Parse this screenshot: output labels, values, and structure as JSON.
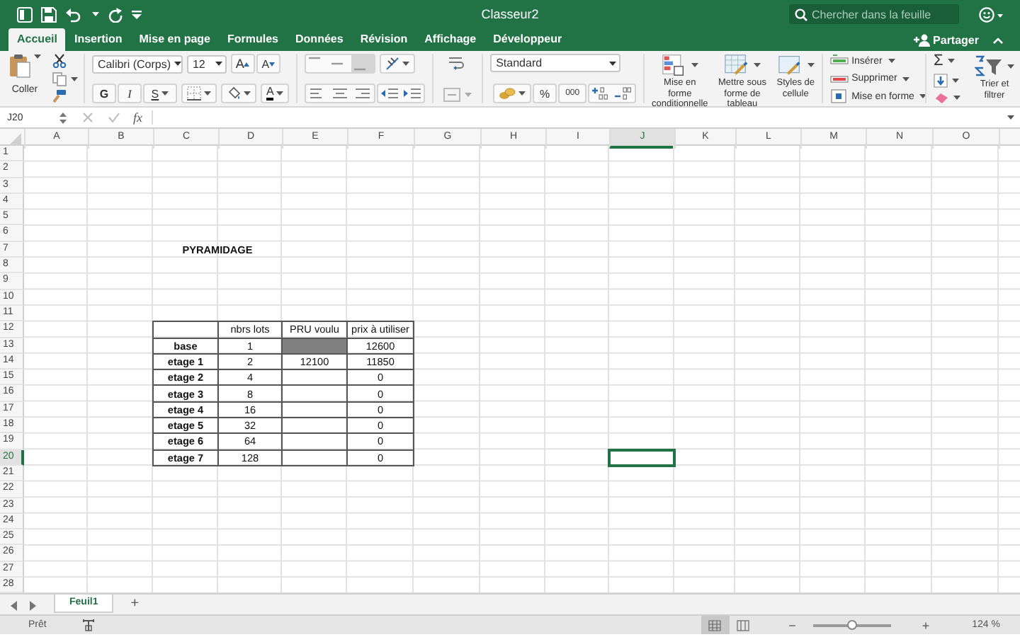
{
  "title_bar": {
    "title": "Classeur2",
    "search": {
      "placeholder": "Chercher dans la feuille"
    }
  },
  "tabs": [
    {
      "label": "Accueil",
      "selected": true
    },
    {
      "label": "Insertion",
      "selected": false
    },
    {
      "label": "Mise en page",
      "selected": false
    },
    {
      "label": "Formules",
      "selected": false
    },
    {
      "label": "Données",
      "selected": false
    },
    {
      "label": "Révision",
      "selected": false
    },
    {
      "label": "Affichage",
      "selected": false
    },
    {
      "label": "Développeur",
      "selected": false
    }
  ],
  "share_button": {
    "label": "Partager"
  },
  "ribbon": {
    "paste_label": "Coller",
    "font": {
      "name": "Calibri (Corps)",
      "size": "12",
      "grow_label": "A",
      "shrink_label": "A",
      "bold_label": "G",
      "italic_label": "I",
      "underline_label": "S",
      "color_label": "A"
    },
    "number": {
      "format": "Standard",
      "percent_label": "%",
      "thousands_label": "000"
    },
    "styles": [
      {
        "label": "Mise en forme\nconditionnelle"
      },
      {
        "label": "Mettre sous\nforme de tableau"
      },
      {
        "label": "Styles de\ncellule"
      }
    ],
    "cells": [
      {
        "label": "Insérer"
      },
      {
        "label": "Supprimer"
      },
      {
        "label": "Mise en forme"
      }
    ],
    "sort_label": "Trier et\nfiltrer",
    "sum_label": "Σ"
  },
  "formula_bar": {
    "name_box": "J20",
    "fx_label": "fx"
  },
  "sheet": {
    "columns": [
      {
        "letter": "A",
        "selected": false
      },
      {
        "letter": "B",
        "selected": false
      },
      {
        "letter": "C",
        "selected": false
      },
      {
        "letter": "D",
        "selected": false
      },
      {
        "letter": "E",
        "selected": false
      },
      {
        "letter": "F",
        "selected": false
      },
      {
        "letter": "G",
        "selected": false
      },
      {
        "letter": "H",
        "selected": false
      },
      {
        "letter": "I",
        "selected": false
      },
      {
        "letter": "J",
        "selected": true
      },
      {
        "letter": "K",
        "selected": false
      },
      {
        "letter": "L",
        "selected": false
      },
      {
        "letter": "M",
        "selected": false
      },
      {
        "letter": "N",
        "selected": false
      },
      {
        "letter": "O",
        "selected": false
      }
    ],
    "rows": [
      {
        "number": "1",
        "selected": false
      },
      {
        "number": "2",
        "selected": false
      },
      {
        "number": "3",
        "selected": false
      },
      {
        "number": "4",
        "selected": false
      },
      {
        "number": "5",
        "selected": false
      },
      {
        "number": "6",
        "selected": false
      },
      {
        "number": "7",
        "selected": false,
        "cells": [
          null,
          null,
          {
            "text": "PYRAMIDAGE",
            "bold": true,
            "merged_across": true
          }
        ]
      },
      {
        "number": "8",
        "selected": false
      },
      {
        "number": "9",
        "selected": false
      },
      {
        "number": "10",
        "selected": false
      },
      {
        "number": "11",
        "selected": false
      },
      {
        "number": "12",
        "selected": false,
        "cells": [
          null,
          null,
          {
            "bordered": true
          },
          {
            "text": "nbrs lots",
            "bordered": true
          },
          {
            "text": "PRU voulu",
            "bordered": true
          },
          {
            "text": "prix à utiliser",
            "bordered": true
          }
        ]
      },
      {
        "number": "13",
        "selected": false,
        "cells": [
          null,
          null,
          {
            "text": "base",
            "bold": true,
            "bordered": true
          },
          {
            "text": "1",
            "bordered": true
          },
          {
            "bordered": true,
            "shaded": true
          },
          {
            "text": "12600",
            "bordered": true
          }
        ]
      },
      {
        "number": "14",
        "selected": false,
        "cells": [
          null,
          null,
          {
            "text": "etage 1",
            "bold": true,
            "bordered": true
          },
          {
            "text": "2",
            "bordered": true
          },
          {
            "text": "12100",
            "bordered": true
          },
          {
            "text": "11850",
            "bordered": true
          }
        ]
      },
      {
        "number": "15",
        "selected": false,
        "cells": [
          null,
          null,
          {
            "text": "etage 2",
            "bold": true,
            "bordered": true
          },
          {
            "text": "4",
            "bordered": true
          },
          {
            "bordered": true
          },
          {
            "text": "0",
            "bordered": true
          }
        ]
      },
      {
        "number": "16",
        "selected": false,
        "cells": [
          null,
          null,
          {
            "text": "etage 3",
            "bold": true,
            "bordered": true
          },
          {
            "text": "8",
            "bordered": true
          },
          {
            "bordered": true
          },
          {
            "text": "0",
            "bordered": true
          }
        ]
      },
      {
        "number": "17",
        "selected": false,
        "cells": [
          null,
          null,
          {
            "text": "etage 4",
            "bold": true,
            "bordered": true
          },
          {
            "text": "16",
            "bordered": true
          },
          {
            "bordered": true
          },
          {
            "text": "0",
            "bordered": true
          }
        ]
      },
      {
        "number": "18",
        "selected": false,
        "cells": [
          null,
          null,
          {
            "text": "etage 5",
            "bold": true,
            "bordered": true
          },
          {
            "text": "32",
            "bordered": true
          },
          {
            "bordered": true
          },
          {
            "text": "0",
            "bordered": true
          }
        ]
      },
      {
        "number": "19",
        "selected": false,
        "cells": [
          null,
          null,
          {
            "text": "etage 6",
            "bold": true,
            "bordered": true
          },
          {
            "text": "64",
            "bordered": true
          },
          {
            "bordered": true
          },
          {
            "text": "0",
            "bordered": true
          }
        ]
      },
      {
        "number": "20",
        "selected": true,
        "cells": [
          null,
          null,
          {
            "text": "etage 7",
            "bold": true,
            "bordered": true
          },
          {
            "text": "128",
            "bordered": true
          },
          {
            "bordered": true
          },
          {
            "text": "0",
            "bordered": true
          }
        ]
      },
      {
        "number": "21",
        "selected": false
      },
      {
        "number": "22",
        "selected": false
      },
      {
        "number": "23",
        "selected": false
      },
      {
        "number": "24",
        "selected": false
      },
      {
        "number": "25",
        "selected": false
      },
      {
        "number": "26",
        "selected": false
      },
      {
        "number": "27",
        "selected": false
      },
      {
        "number": "28",
        "selected": false
      }
    ]
  },
  "sheet_tabs": [
    {
      "label": "Feuil1",
      "selected": true
    }
  ],
  "add_sheet_label": "+",
  "status_bar": {
    "status": "Prêt",
    "zoom_out_label": "−",
    "zoom_in_label": "+",
    "zoom": {
      "level": 0.5,
      "reading": "124 %"
    }
  }
}
